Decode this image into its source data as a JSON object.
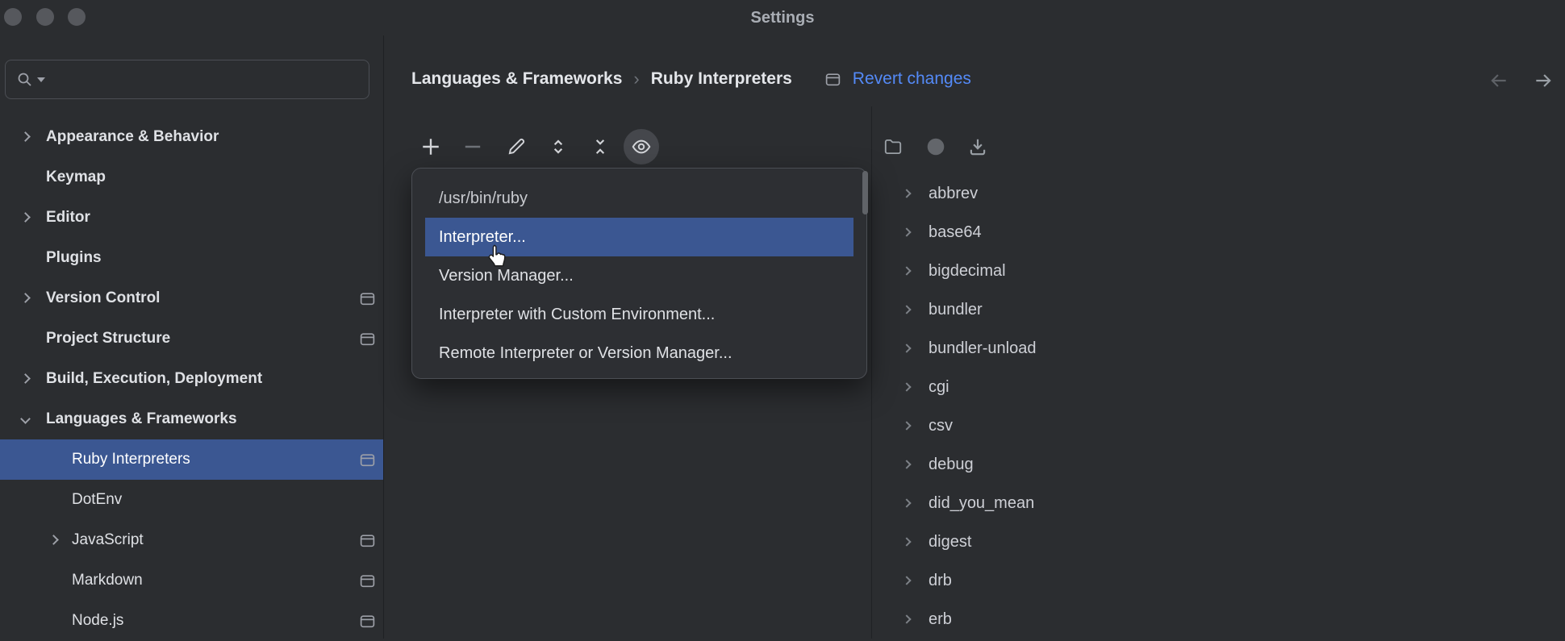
{
  "window": {
    "title": "Settings"
  },
  "sidebar": {
    "items": [
      {
        "label": "Appearance & Behavior"
      },
      {
        "label": "Keymap"
      },
      {
        "label": "Editor"
      },
      {
        "label": "Plugins"
      },
      {
        "label": "Version Control"
      },
      {
        "label": "Project Structure"
      },
      {
        "label": "Build, Execution, Deployment"
      },
      {
        "label": "Languages & Frameworks"
      },
      {
        "label": "Ruby Interpreters"
      },
      {
        "label": "DotEnv"
      },
      {
        "label": "JavaScript"
      },
      {
        "label": "Markdown"
      },
      {
        "label": "Node.js"
      }
    ]
  },
  "breadcrumb": {
    "parent": "Languages & Frameworks",
    "separator": "›",
    "current": "Ruby Interpreters"
  },
  "actions": {
    "revert": "Revert changes"
  },
  "interpreter_list": {
    "first_item": "/usr/bin/ruby"
  },
  "add_menu": {
    "items": [
      {
        "label": "Interpreter..."
      },
      {
        "label": "Version Manager..."
      },
      {
        "label": "Interpreter with Custom Environment..."
      },
      {
        "label": "Remote Interpreter or Version Manager..."
      }
    ]
  },
  "gems": {
    "items": [
      "abbrev",
      "base64",
      "bigdecimal",
      "bundler",
      "bundler-unload",
      "cgi",
      "csv",
      "debug",
      "did_you_mean",
      "digest",
      "drb",
      "erb"
    ]
  },
  "colors": {
    "background": "#2b2d30",
    "selection": "#3b5792",
    "link": "#548af7",
    "panel_border": "#4b4e54"
  }
}
